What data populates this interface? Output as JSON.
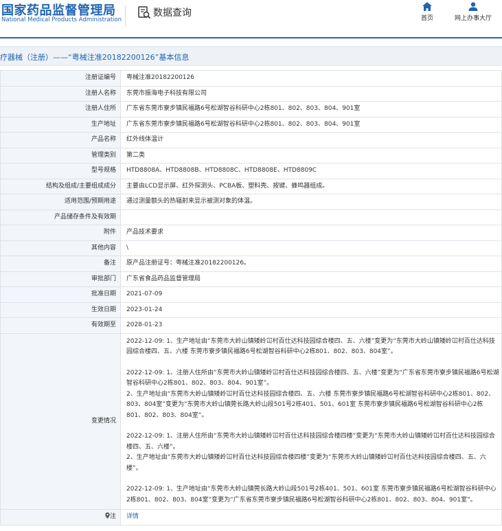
{
  "header": {
    "logo_cn": "国家药品监督管理局",
    "logo_en": "National Medical Products Administration",
    "search_title": "数据查询",
    "nav_home": "首页",
    "nav_hall": "网上办事大厅"
  },
  "breadcrumb": "疗器械（注册）——“粤械注准20182200126”基本信息",
  "rows": [
    {
      "label": "注册证编号",
      "value": "粤械注准20182200126"
    },
    {
      "label": "注册人名称",
      "value": "东莞市振海电子科技有限公司"
    },
    {
      "label": "注册人住所",
      "value": "广东省东莞市寮步镇民福路6号松湖智谷科研中心2栋801、802、803、804、901室"
    },
    {
      "label": "生产地址",
      "value": "广东省东莞市寮步镇民福路6号松湖智谷科研中心2栋801、802、803、804、901室"
    },
    {
      "label": "产品名称",
      "value": "红外线体温计"
    },
    {
      "label": "管理类别",
      "value": "第二类"
    },
    {
      "label": "型号规格",
      "value": "HTD8808A、HTD8808B、HTD8808C、HTD8808E、HTD8809C"
    },
    {
      "label": "结构及组成/主要组成成分",
      "value": "主要由LCD显示屏、红外探测头、PCBA板、塑料壳、按键、蜂鸣器组成。"
    },
    {
      "label": "适用范围/预期用途",
      "value": "通过测量额头的热辐射来显示被测对象的体温。"
    },
    {
      "label": "产品储存条件及有效期",
      "value": ""
    },
    {
      "label": "附件",
      "value": "产品技术要求"
    },
    {
      "label": "其他内容",
      "value": "\\"
    },
    {
      "label": "备注",
      "value": "原产品注册证号：粤械注准20182200126。"
    },
    {
      "label": "审批部门",
      "value": "广东省食品药品监督管理局"
    },
    {
      "label": "批准日期",
      "value": "2021-07-09"
    },
    {
      "label": "生效日期",
      "value": "2023-01-24"
    },
    {
      "label": "有效期至",
      "value": "2028-01-23"
    }
  ],
  "change": {
    "label": "变更情况",
    "paragraphs": [
      "2022-12-09: 1、生产地址由“东莞市大岭山镇矮岭冚村百仕达科技园综合楼四、五、六楼”变更为“东莞市大岭山镇矮岭冚村百仕达科技园综合楼四、五、六楼 东莞市寮步镇民福路6号松湖智谷科研中心2栋801、802、803、804室”。",
      "2022-12-09: 1、注册人住所由“东莞市大岭山镇矮岭冚村百仕达科技园综合楼四、五、六楼”变更为“广东省东莞市寮步镇民福路6号松湖智谷科研中心2栋801、802、803、804、901室”。",
      "2、生产地址由“东莞市大岭山镇矮岭冚村百仕达科技园综合楼四、五、六楼 东莞市寮步镇民福路6号松湖智谷科研中心2栋801、802、803、804室”变更为“东莞市大岭山镇莞长路大岭山段501号2栋401、501、601室 东莞市寮步镇民福路6号松湖智谷科研中心2栋801、802、803、804室”。",
      "2022-12-09: 1、注册人住所由“东莞市大岭山镇矮岭冚村百仕达科技园综合楼四楼”变更为“东莞市大岭山镇矮岭冚村百仕达科技园综合楼四、五、六楼”。",
      "2、生产地址由“东莞市大岭山镇矮岭冚村百仕达科技园综合楼四楼”变更为“东莞市大岭山镇矮岭冚村百仕达科技园综合楼四、五、六楼”。",
      "2022-12-09: 1、生产地址由“东莞市大岭山镇莞长路大岭山段501号2栋401、501、601室 东莞市寮步镇民福路6号松湖智谷科研中心2栋801、802、803、804室”变更为“广东省东莞市寮步镇民福路6号松湖智谷科研中心2栋801、802、803、804、901室”。"
    ]
  },
  "note": {
    "label": "注",
    "link": "详情"
  },
  "colors": {
    "brand": "#1f64b1",
    "label_bg": "#f2f5f9",
    "border": "#dde2e8"
  },
  "icons": [
    "search-doc-icon",
    "home-icon",
    "user-icon",
    "pin-icon"
  ]
}
